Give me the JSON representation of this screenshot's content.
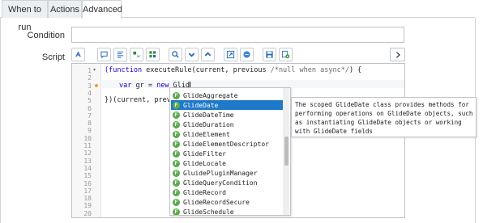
{
  "tabs": [
    {
      "label": "When to run"
    },
    {
      "label": "Actions"
    },
    {
      "label": "Advanced"
    }
  ],
  "active_tab": "Advanced",
  "form": {
    "condition_label": "Condition",
    "condition_value": "",
    "script_label": "Script"
  },
  "toolbar": {
    "buttons": [
      "script-debugger-icon",
      "comment-icon",
      "format-icon",
      "replace-icon",
      "replace-all-icon",
      "search-icon",
      "find-next-icon",
      "find-prev-icon",
      "fullscreen-icon",
      "syntax-check-icon",
      "save-icon",
      "script-include-icon"
    ],
    "expand_label": ">"
  },
  "editor": {
    "line_numbers": [
      "1",
      "2",
      "3",
      "4",
      "5",
      "6",
      "7",
      "8",
      "9",
      "10",
      "11",
      "12",
      "13",
      "14",
      "15",
      "16",
      "17",
      "18",
      "19",
      "20"
    ],
    "fold_marker": "▾",
    "line1_kw1": "(function",
    "line1_mid": " executeRule(current, previous ",
    "line1_comment": "/*null when async*/",
    "line1_end": ") {",
    "line3_kw1": "var",
    "line3_mid": " gr = ",
    "line3_kw2": "new",
    "line3_end": " Glid",
    "line5": "})(current, previ"
  },
  "autocomplete": {
    "badge": "F",
    "items": [
      "GlideAggregate",
      "GlideDate",
      "GlideDateTime",
      "GlideDuration",
      "GlideElement",
      "GlideElementDescriptor",
      "GlideFilter",
      "GlideLocale",
      "GluidePluginManager",
      "GlideQueryCondition",
      "GlideRecord",
      "GlideRecordSecure",
      "GlideSchedule"
    ],
    "selected_index": 1,
    "doc": "The scoped GlideDate class provides methods for\nperforming operations on GlideDate objects, such\nas instantiating GlideDate objects or working\nwith GlideDate fields"
  },
  "colors": {
    "selection": "#1f79c9",
    "badge": "#5aa94d",
    "keyword": "#1c00cf"
  }
}
